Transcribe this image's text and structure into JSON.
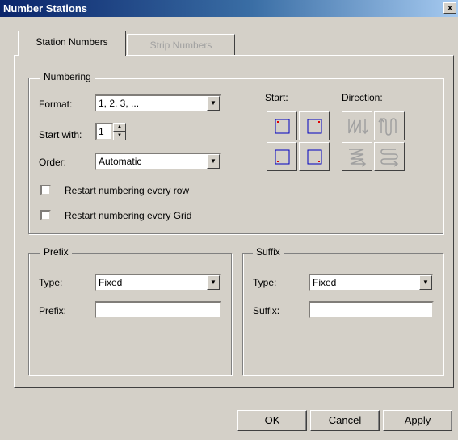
{
  "window": {
    "title": "Number Stations",
    "close_glyph": "x"
  },
  "tabs": [
    {
      "label": "Station Numbers",
      "active": true
    },
    {
      "label": "Strip Numbers",
      "active": false
    }
  ],
  "numbering": {
    "legend": "Numbering",
    "format_label": "Format:",
    "format_value": "1, 2, 3, ...",
    "start_with_label": "Start with:",
    "start_with_value": "1",
    "order_label": "Order:",
    "order_value": "Automatic",
    "restart_row_label": "Restart numbering every row",
    "restart_row_checked": false,
    "restart_grid_label": "Restart numbering every Grid",
    "restart_grid_checked": false,
    "start_label": "Start:",
    "direction_label": "Direction:",
    "start_icons": [
      "start-top-left-icon",
      "start-top-right-icon",
      "start-bottom-left-icon",
      "start-bottom-right-icon"
    ],
    "direction_icons": [
      "serpentine-vertical-down-icon",
      "serpentine-vertical-up-icon",
      "serpentine-horizontal-z-icon",
      "serpentine-horizontal-loop-icon"
    ],
    "accent_blue": "#0000c0",
    "accent_red": "#e00000"
  },
  "prefix": {
    "legend": "Prefix",
    "type_label": "Type:",
    "type_value": "Fixed",
    "field_label": "Prefix:",
    "field_value": ""
  },
  "suffix": {
    "legend": "Suffix",
    "type_label": "Type:",
    "type_value": "Fixed",
    "field_label": "Suffix:",
    "field_value": ""
  },
  "buttons": {
    "ok": "OK",
    "cancel": "Cancel",
    "apply": "Apply"
  }
}
